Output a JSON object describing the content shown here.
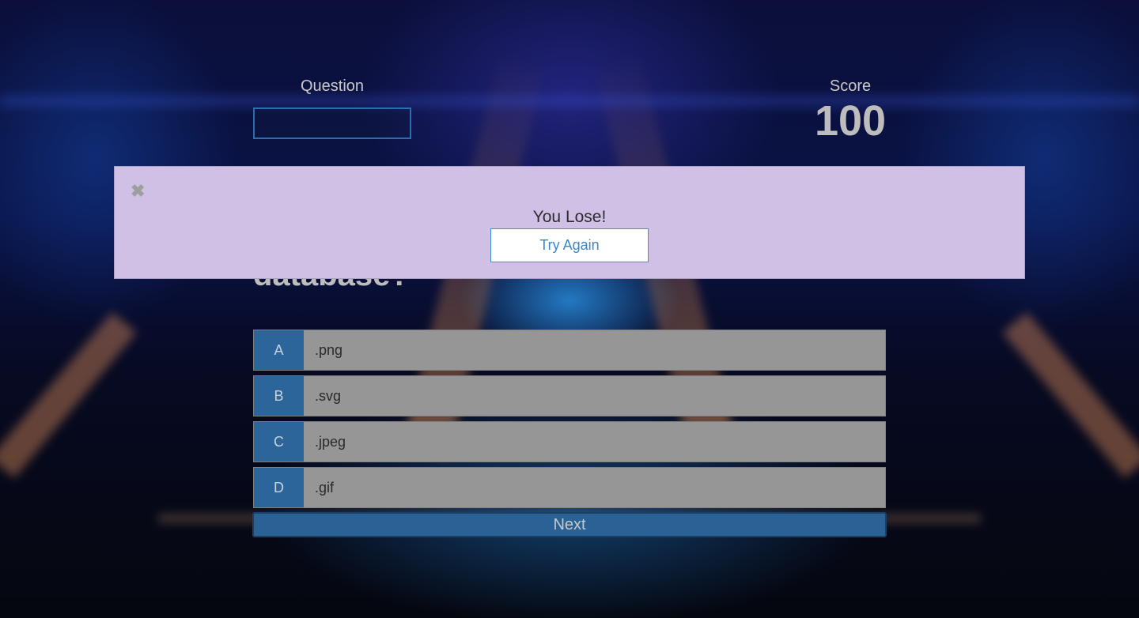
{
  "header": {
    "question_label": "Question",
    "question_value": "",
    "score_label": "Score",
    "score_value": "100"
  },
  "question": {
    "text_visible_fragment": "database?"
  },
  "answers": [
    {
      "letter": "A",
      "text": ".png"
    },
    {
      "letter": "B",
      "text": ".svg"
    },
    {
      "letter": "C",
      "text": ".jpeg"
    },
    {
      "letter": "D",
      "text": ".gif"
    }
  ],
  "next_label": "Next",
  "modal": {
    "title": "You Lose!",
    "button_label": "Try Again",
    "close_glyph": "✖",
    "close_icon": "close-icon"
  },
  "colors": {
    "accent_blue": "#2c6599",
    "modal_bg": "#d0c0e6",
    "answer_bg": "#969696",
    "try_again_text": "#3a86cc"
  }
}
